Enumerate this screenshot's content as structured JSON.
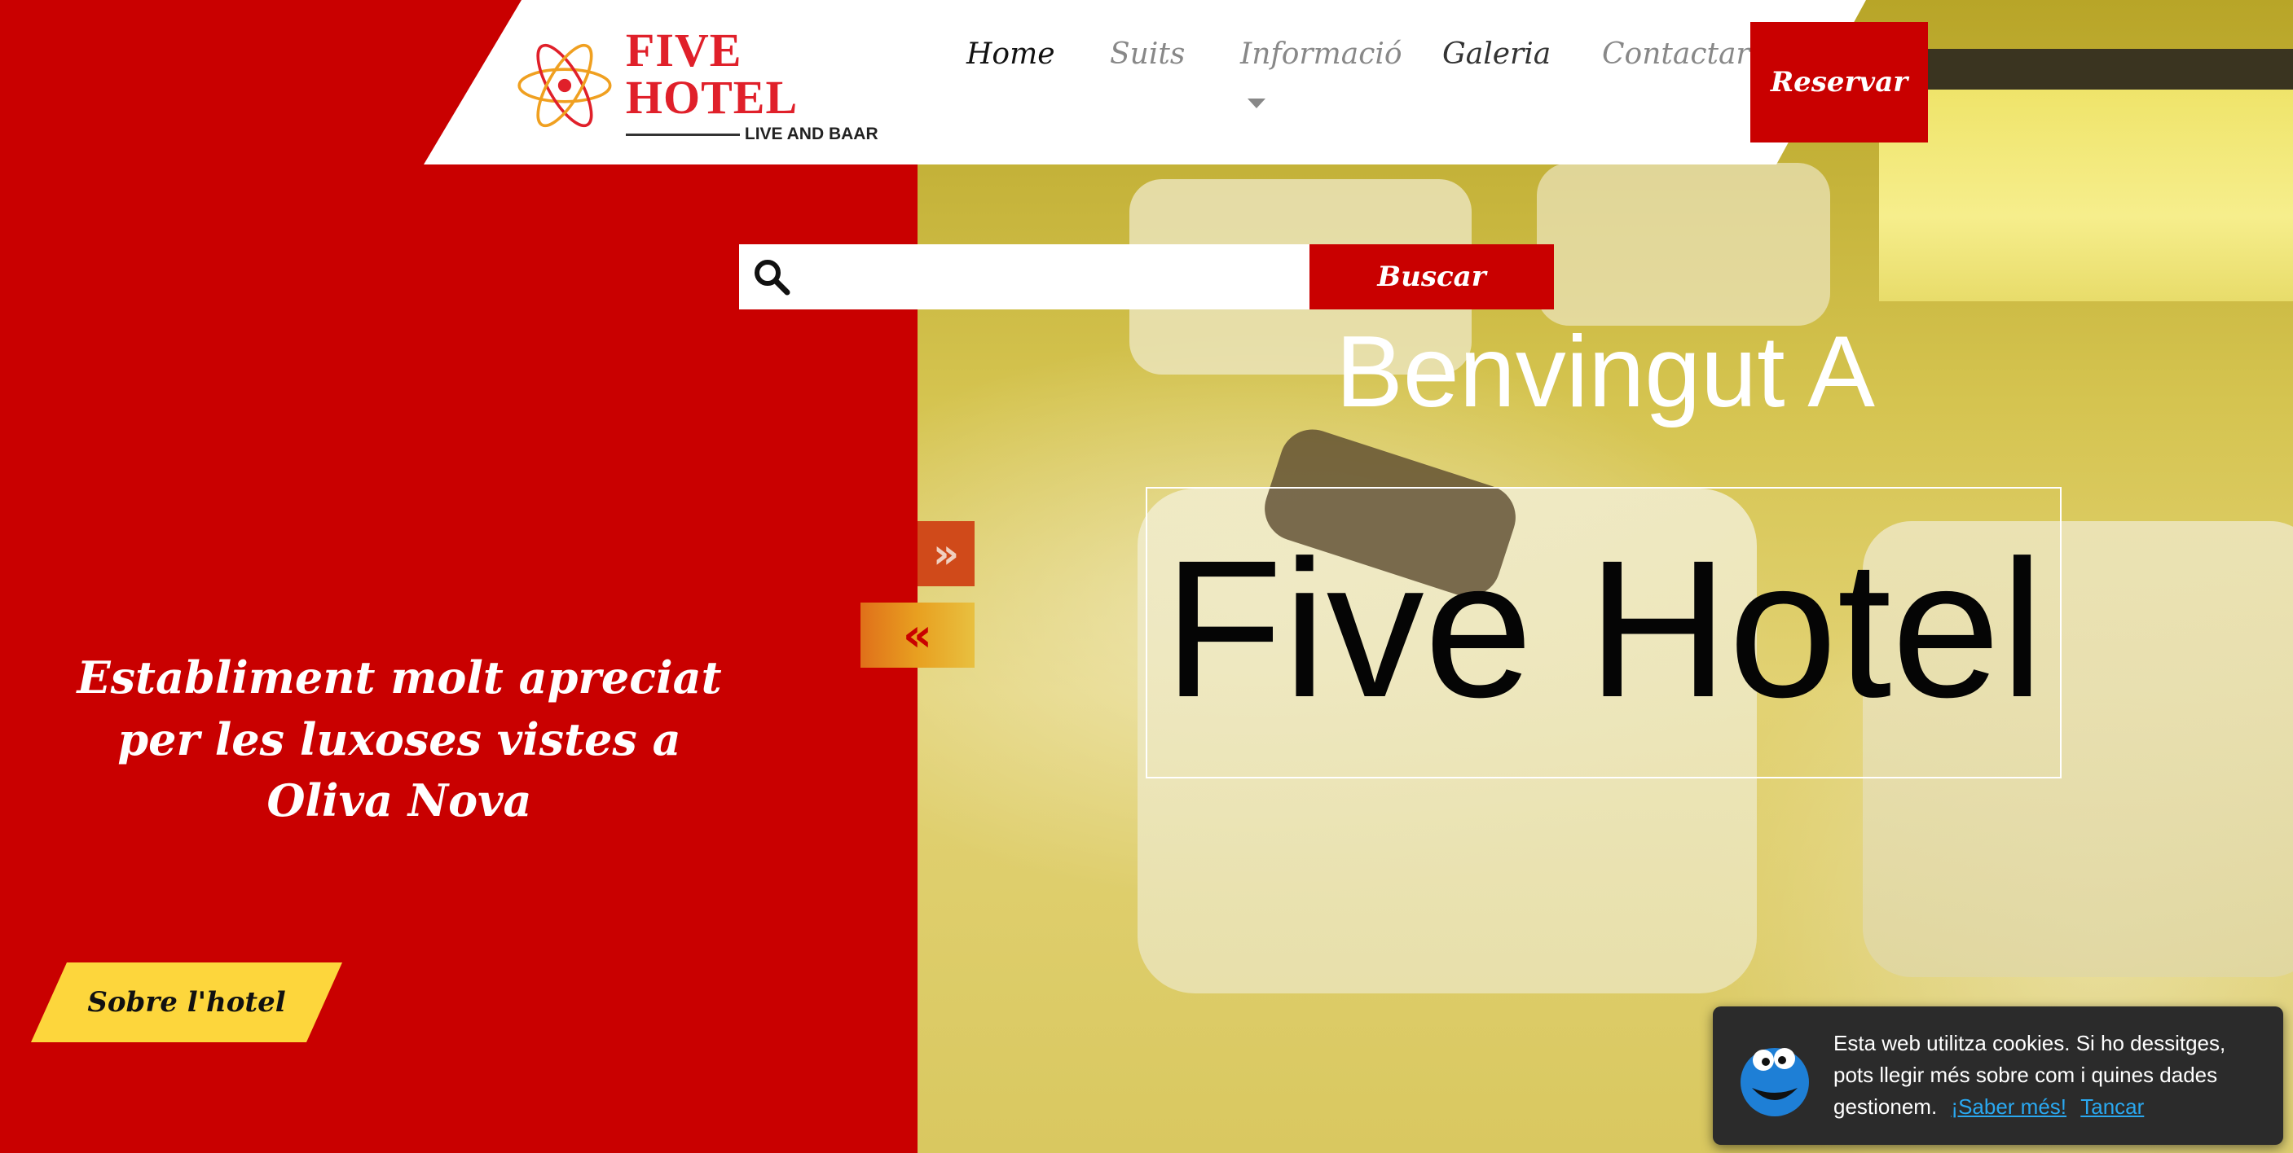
{
  "brand": {
    "title": "FIVE HOTEL",
    "subtitle": "LIVE AND BAAR",
    "colors": {
      "primary_red": "#c90000",
      "accent_yellow": "#fdd63c",
      "logo_red": "#e0202a"
    }
  },
  "nav": {
    "items": [
      {
        "label": "Home",
        "active": true
      },
      {
        "label": "Suits"
      },
      {
        "label": "Informació",
        "has_dropdown": true
      },
      {
        "label": "Galeria"
      },
      {
        "label": "Contactar"
      }
    ],
    "reserve_label": "Reservar"
  },
  "search": {
    "placeholder": "",
    "value": "",
    "button_label": "Buscar",
    "icon": "search-icon"
  },
  "hero": {
    "welcome": "Benvingut A",
    "name": "Five Hotel",
    "tagline": "Establiment molt apreciat per les luxoses vistes a Oliva Nova",
    "about_button": "Sobre l'hotel",
    "next_arrow": "»",
    "prev_arrow": "«"
  },
  "cookie_notice": {
    "text": "Esta web utilitza cookies. Si ho dessitges, pots llegir més sobre com i quines dades gestionem.",
    "learn_more": "¡Saber més!",
    "close": "Tancar",
    "icon": "cookie-monster-icon"
  }
}
